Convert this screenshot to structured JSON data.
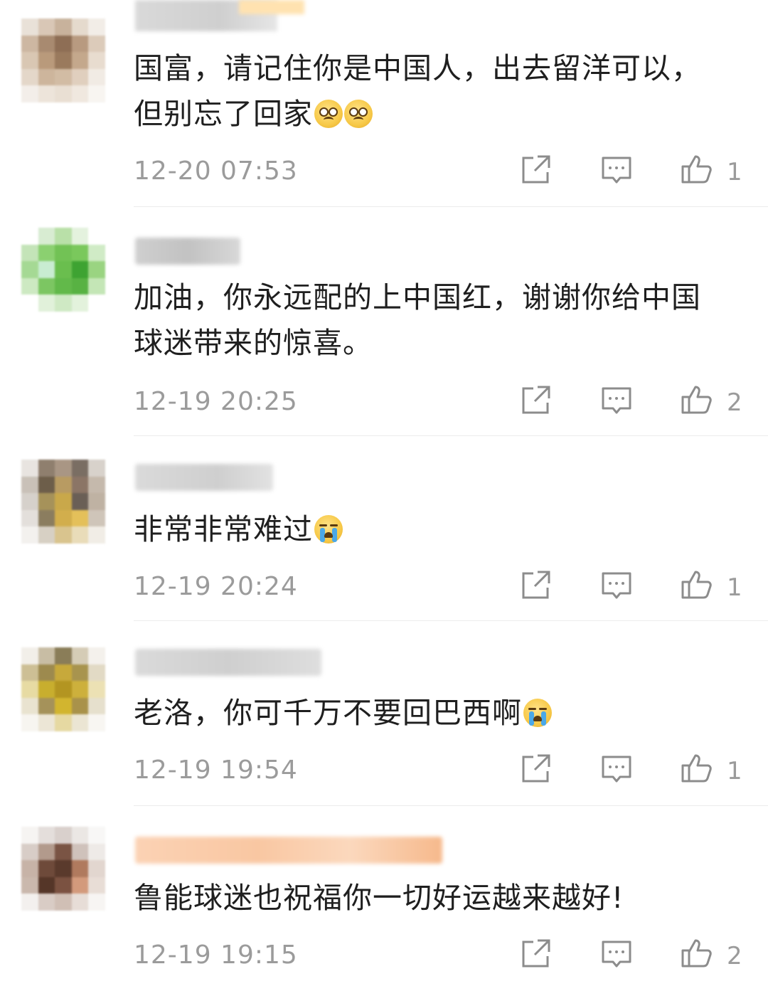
{
  "comments": [
    {
      "text": "国富，请记住你是中国人，出去留洋可以，\n但别忘了回家",
      "emojis": [
        "pleading-face",
        "pleading-face"
      ],
      "time": "12-20 07:53",
      "likes": "1"
    },
    {
      "text": "加油，你永远配的上中国红，谢谢你给中国\n球迷带来的惊喜。",
      "emojis": [],
      "time": "12-19 20:25",
      "likes": "2"
    },
    {
      "text": "非常非常难过",
      "emojis": [
        "crying-face"
      ],
      "time": "12-19 20:24",
      "likes": "1"
    },
    {
      "text": "老洛，你可千万不要回巴西啊",
      "emojis": [
        "crying-face"
      ],
      "time": "12-19 19:54",
      "likes": "1"
    },
    {
      "text": "鲁能球迷也祝福你一切好运越来越好!",
      "emojis": [],
      "time": "12-19 19:15",
      "likes": "2"
    }
  ],
  "icons": {
    "share": "share-icon",
    "reply": "comment-icon",
    "like": "thumbs-up-icon"
  },
  "colors": {
    "text": "#1f1f1f",
    "meta": "#9b9b9b",
    "divider": "#ececec"
  }
}
